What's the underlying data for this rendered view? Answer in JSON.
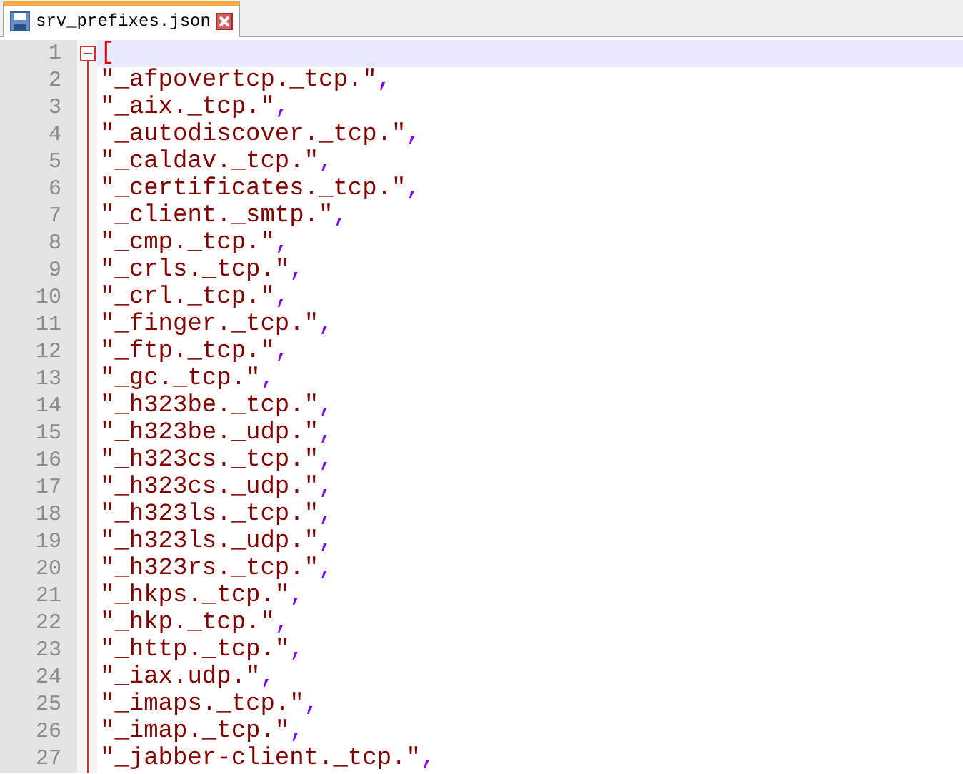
{
  "tabs": [
    {
      "title": "srv_prefixes.json",
      "selected": true
    }
  ],
  "lines": [
    {
      "number": "1",
      "kind": "open",
      "text": "[",
      "current": true,
      "fold": true
    },
    {
      "number": "2",
      "kind": "string",
      "text": "\"_afpovertcp._tcp.\"",
      "punct": ",",
      "current": false
    },
    {
      "number": "3",
      "kind": "string",
      "text": "\"_aix._tcp.\"",
      "punct": ",",
      "current": false
    },
    {
      "number": "4",
      "kind": "string",
      "text": "\"_autodiscover._tcp.\"",
      "punct": ",",
      "current": false
    },
    {
      "number": "5",
      "kind": "string",
      "text": "\"_caldav._tcp.\"",
      "punct": ",",
      "current": false
    },
    {
      "number": "6",
      "kind": "string",
      "text": "\"_certificates._tcp.\"",
      "punct": ",",
      "current": false
    },
    {
      "number": "7",
      "kind": "string",
      "text": "\"_client._smtp.\"",
      "punct": ",",
      "current": false
    },
    {
      "number": "8",
      "kind": "string",
      "text": "\"_cmp._tcp.\"",
      "punct": ",",
      "current": false
    },
    {
      "number": "9",
      "kind": "string",
      "text": "\"_crls._tcp.\"",
      "punct": ",",
      "current": false
    },
    {
      "number": "10",
      "kind": "string",
      "text": "\"_crl._tcp.\"",
      "punct": ",",
      "current": false
    },
    {
      "number": "11",
      "kind": "string",
      "text": "\"_finger._tcp.\"",
      "punct": ",",
      "current": false
    },
    {
      "number": "12",
      "kind": "string",
      "text": "\"_ftp._tcp.\"",
      "punct": ",",
      "current": false
    },
    {
      "number": "13",
      "kind": "string",
      "text": "\"_gc._tcp.\"",
      "punct": ",",
      "current": false
    },
    {
      "number": "14",
      "kind": "string",
      "text": "\"_h323be._tcp.\"",
      "punct": ",",
      "current": false
    },
    {
      "number": "15",
      "kind": "string",
      "text": "\"_h323be._udp.\"",
      "punct": ",",
      "current": false
    },
    {
      "number": "16",
      "kind": "string",
      "text": "\"_h323cs._tcp.\"",
      "punct": ",",
      "current": false
    },
    {
      "number": "17",
      "kind": "string",
      "text": "\"_h323cs._udp.\"",
      "punct": ",",
      "current": false
    },
    {
      "number": "18",
      "kind": "string",
      "text": "\"_h323ls._tcp.\"",
      "punct": ",",
      "current": false
    },
    {
      "number": "19",
      "kind": "string",
      "text": "\"_h323ls._udp.\"",
      "punct": ",",
      "current": false
    },
    {
      "number": "20",
      "kind": "string",
      "text": "\"_h323rs._tcp.\"",
      "punct": ",",
      "current": false
    },
    {
      "number": "21",
      "kind": "string",
      "text": "\"_hkps._tcp.\"",
      "punct": ",",
      "current": false
    },
    {
      "number": "22",
      "kind": "string",
      "text": "\"_hkp._tcp.\"",
      "punct": ",",
      "current": false
    },
    {
      "number": "23",
      "kind": "string",
      "text": "\"_http._tcp.\"",
      "punct": ",",
      "current": false
    },
    {
      "number": "24",
      "kind": "string",
      "text": "\"_iax.udp.\"",
      "punct": ",",
      "current": false
    },
    {
      "number": "25",
      "kind": "string",
      "text": "\"_imaps._tcp.\"",
      "punct": ",",
      "current": false
    },
    {
      "number": "26",
      "kind": "string",
      "text": "\"_imap._tcp.\"",
      "punct": ",",
      "current": false
    },
    {
      "number": "27",
      "kind": "string",
      "text": "\"_jabber-client._tcp.\"",
      "punct": ",",
      "current": false
    }
  ]
}
